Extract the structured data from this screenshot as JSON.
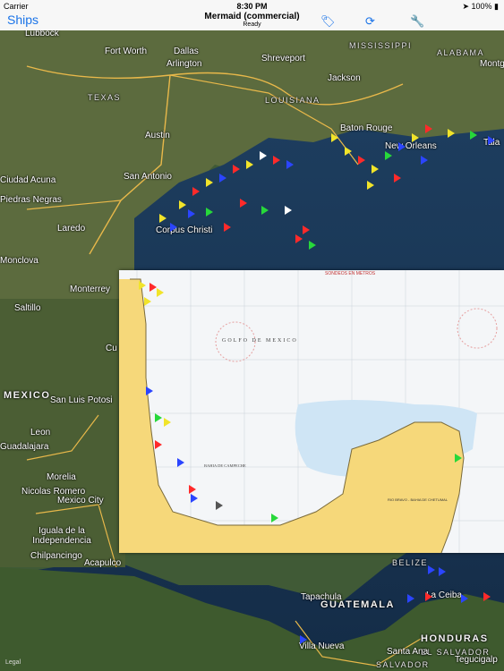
{
  "status": {
    "carrier": "Carrier",
    "time": "8:30 PM",
    "battery": "100%"
  },
  "nav": {
    "back": "Ships",
    "title": "Mermaid (commercial)",
    "subtitle": "Ready"
  },
  "map": {
    "states": [
      "TEXAS",
      "LOUISIANA",
      "MISSISSIPPI",
      "ALABAMA"
    ],
    "countries": [
      "MEXICO",
      "GUATEMALA",
      "HONDURAS",
      "BELIZE",
      "EL SALVADOR"
    ],
    "cities": [
      "Lubbock",
      "Fort Worth",
      "Dallas",
      "Arlington",
      "Shreveport",
      "Jackson",
      "Montg",
      "Austin",
      "San Antonio",
      "Baton Rouge",
      "New Orleans",
      "Tala",
      "Ciudad Acuna",
      "Piedras Negras",
      "Laredo",
      "Corpus Christi",
      "Monclova",
      "Monterrey",
      "Saltillo",
      "San Luis Potosi",
      "Leon",
      "Guadalajara",
      "Morelia",
      "Nicolas Romero",
      "Mexico City",
      "Iguala de la Independencia",
      "Chilpancingo",
      "Acapulco",
      "Tapachula",
      "Villa Nueva",
      "La Ceiba",
      "Santa Ana",
      "Tegucigalp",
      "SALVADOR",
      "Cu"
    ],
    "legal": "Legal"
  },
  "chart_overlay": {
    "title": "GOLFO DE MEXICO",
    "subtitle": "BAHIA DE CAMPECHE",
    "scale_label": "SONDEOS EN METROS",
    "name": "RIO BRAVO - BAHIA DE CHETUMAL"
  }
}
